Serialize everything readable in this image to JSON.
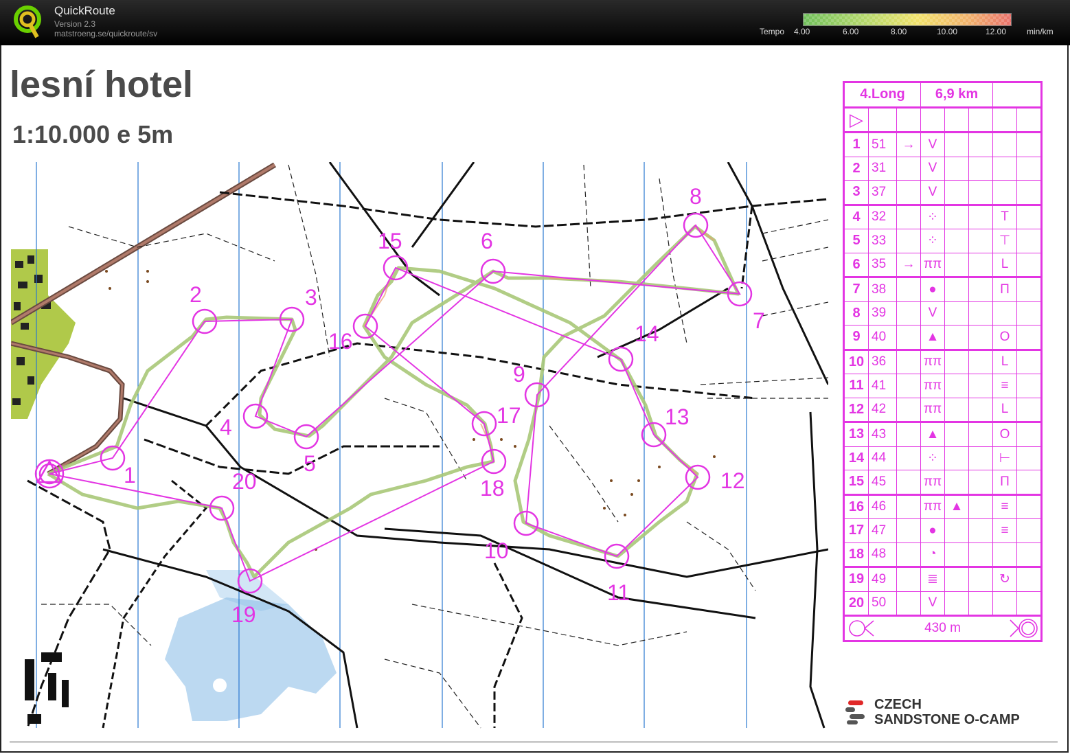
{
  "app": {
    "name": "QuickRoute",
    "version": "Version 2.3",
    "url": "matstroeng.se/quickroute/sv"
  },
  "tempo": {
    "label": "Tempo",
    "ticks": [
      "4.00",
      "6.00",
      "8.00",
      "10.00",
      "12.00"
    ],
    "unit": "min/km",
    "colors": [
      "#2e8b2e",
      "#9acd32",
      "#f0e040",
      "#f0a040",
      "#e04040"
    ]
  },
  "map": {
    "title": "lesní hotel",
    "scale": "1:10.000  e 5m",
    "course_color": "#e335e3",
    "controls": [
      {
        "label": "1"
      },
      {
        "label": "2"
      },
      {
        "label": "3"
      },
      {
        "label": "4"
      },
      {
        "label": "5"
      },
      {
        "label": "6"
      },
      {
        "label": "7"
      },
      {
        "label": "8"
      },
      {
        "label": "9"
      },
      {
        "label": "10"
      },
      {
        "label": "11"
      },
      {
        "label": "12"
      },
      {
        "label": "13"
      },
      {
        "label": "14"
      },
      {
        "label": "15"
      },
      {
        "label": "16"
      },
      {
        "label": "17"
      },
      {
        "label": "18"
      },
      {
        "label": "19"
      },
      {
        "label": "20"
      }
    ]
  },
  "control_descriptions": {
    "course": "4.Long",
    "length": "6,9 km",
    "start_symbol": "▷",
    "rows": [
      {
        "n": "1",
        "code": "51",
        "c": "→",
        "d": "V",
        "e": "",
        "g": ""
      },
      {
        "n": "2",
        "code": "31",
        "c": "",
        "d": "V",
        "e": "",
        "g": ""
      },
      {
        "n": "3",
        "code": "37",
        "c": "",
        "d": "V",
        "e": "",
        "g": ""
      },
      {
        "n": "4",
        "code": "32",
        "c": "",
        "d": "⁘",
        "e": "",
        "g": "T"
      },
      {
        "n": "5",
        "code": "33",
        "c": "",
        "d": "⁘",
        "e": "",
        "g": "⊤"
      },
      {
        "n": "6",
        "code": "35",
        "c": "→",
        "d": "ππ",
        "e": "",
        "g": "L"
      },
      {
        "n": "7",
        "code": "38",
        "c": "",
        "d": "●",
        "e": "",
        "g": "Π"
      },
      {
        "n": "8",
        "code": "39",
        "c": "",
        "d": "V",
        "e": "",
        "g": ""
      },
      {
        "n": "9",
        "code": "40",
        "c": "",
        "d": "▲",
        "e": "",
        "g": "O"
      },
      {
        "n": "10",
        "code": "36",
        "c": "",
        "d": "ππ",
        "e": "",
        "g": "L"
      },
      {
        "n": "11",
        "code": "41",
        "c": "",
        "d": "ππ",
        "e": "",
        "g": "≡"
      },
      {
        "n": "12",
        "code": "42",
        "c": "",
        "d": "ππ",
        "e": "",
        "g": "L"
      },
      {
        "n": "13",
        "code": "43",
        "c": "",
        "d": "▲",
        "e": "",
        "g": "O"
      },
      {
        "n": "14",
        "code": "44",
        "c": "",
        "d": "⁘",
        "e": "",
        "g": "⊢"
      },
      {
        "n": "15",
        "code": "45",
        "c": "",
        "d": "ππ",
        "e": "",
        "g": "Π"
      },
      {
        "n": "16",
        "code": "46",
        "c": "",
        "d": "ππ",
        "e": "▲",
        "g": "≡"
      },
      {
        "n": "17",
        "code": "47",
        "c": "",
        "d": "●",
        "e": "",
        "g": "≡"
      },
      {
        "n": "18",
        "code": "48",
        "c": "",
        "d": "◔",
        "e": "",
        "g": ""
      },
      {
        "n": "19",
        "code": "49",
        "c": "",
        "d": "≣",
        "e": "",
        "g": "↻"
      },
      {
        "n": "20",
        "code": "50",
        "c": "",
        "d": "V",
        "e": "",
        "g": ""
      }
    ],
    "finish": "430 m"
  },
  "sponsor": {
    "line1": "CZECH",
    "line2": "SANDSTONE O-CAMP"
  }
}
